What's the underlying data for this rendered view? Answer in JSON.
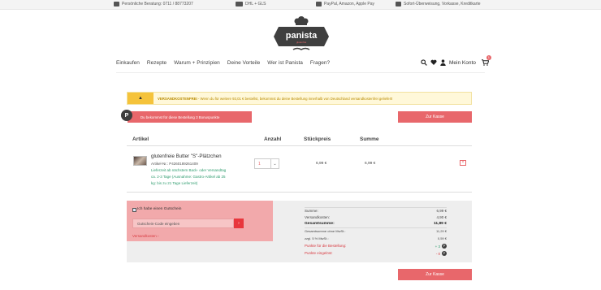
{
  "topbar": {
    "phone": "Persönliche Beratung: 0711 / 88773207",
    "shipping": "DHL + GLS",
    "payment": "PayPal, Amazon, Apple Pay",
    "transfer": "Sofort-Überweisung, Vorkasse, Kreditkarte"
  },
  "logo": {
    "name": "panista",
    "sub": "glutenfrei"
  },
  "nav": {
    "items": [
      "Einkaufen",
      "Rezepte",
      "Warum + Prinzipien",
      "Deine Vorteile",
      "Wer ist Panista",
      "Fragen?"
    ],
    "account_label": "Mein Konto",
    "cart_count": "1"
  },
  "notice": {
    "title": "VERSANDKOSTENFREI",
    "text": " - Wenn du für weitere 93,01 € bestellst, bekommst du deine Bestellung innerhalb von Deutschland versandkostenfrei geliefert!"
  },
  "bonus": {
    "badge": "P",
    "text": "Du bekommst für diese Bestellung 3 Bonuspunkte"
  },
  "checkout_label": "Zur Kasse",
  "table": {
    "headers": {
      "item": "Artikel",
      "qty": "Anzahl",
      "unit": "Stückpreis",
      "sum": "Summe"
    },
    "product": {
      "name": "glutenfreie Butter \"S\"-Plätzchen",
      "number": "Artikel-Nr.: P4260189261409",
      "delivery": [
        "Lieferzeit ab nächstem Back- oder Versandtag",
        "ca. 2-3 Tage (Ausnahme: Gastro-Artikel ab 25",
        "kg: bis zu 21 Tage Lieferzeit)"
      ],
      "qty": "1",
      "unit_price": "6,99 €",
      "total": "6,99 €"
    }
  },
  "coupon": {
    "checkbox_label": "Ich habe einen Gutschein",
    "placeholder": "Gutschein-Code eingeben",
    "go": "›",
    "shipping_link": "Versandkosten ›"
  },
  "summary": [
    {
      "label": "Summe:",
      "value": "6,99 €",
      "style": ""
    },
    {
      "label": "Versandkosten:",
      "value": "4,90 €",
      "style": ""
    },
    {
      "label": "Gesamtsumme:",
      "value": "11,89 €",
      "style": "strong"
    },
    {
      "label": "Gesamtsumme ohne MwSt.:",
      "value": "11,29 €",
      "style": "small"
    },
    {
      "label": "zzgl. 5 % MwSt.:",
      "value": "0,59 €",
      "style": "small"
    },
    {
      "label": "Punkte für die Bestellung:",
      "value": "+ 3",
      "style": "red green",
      "badge": "P"
    },
    {
      "label": "Punkte eingelöst:",
      "value": "- 0",
      "style": "red redv",
      "badge": "P"
    }
  ],
  "colors": {
    "accent": "#e8676b",
    "notice_bg": "#fff8d9",
    "green": "#2e9c6e",
    "dark": "#3d3d3d"
  }
}
